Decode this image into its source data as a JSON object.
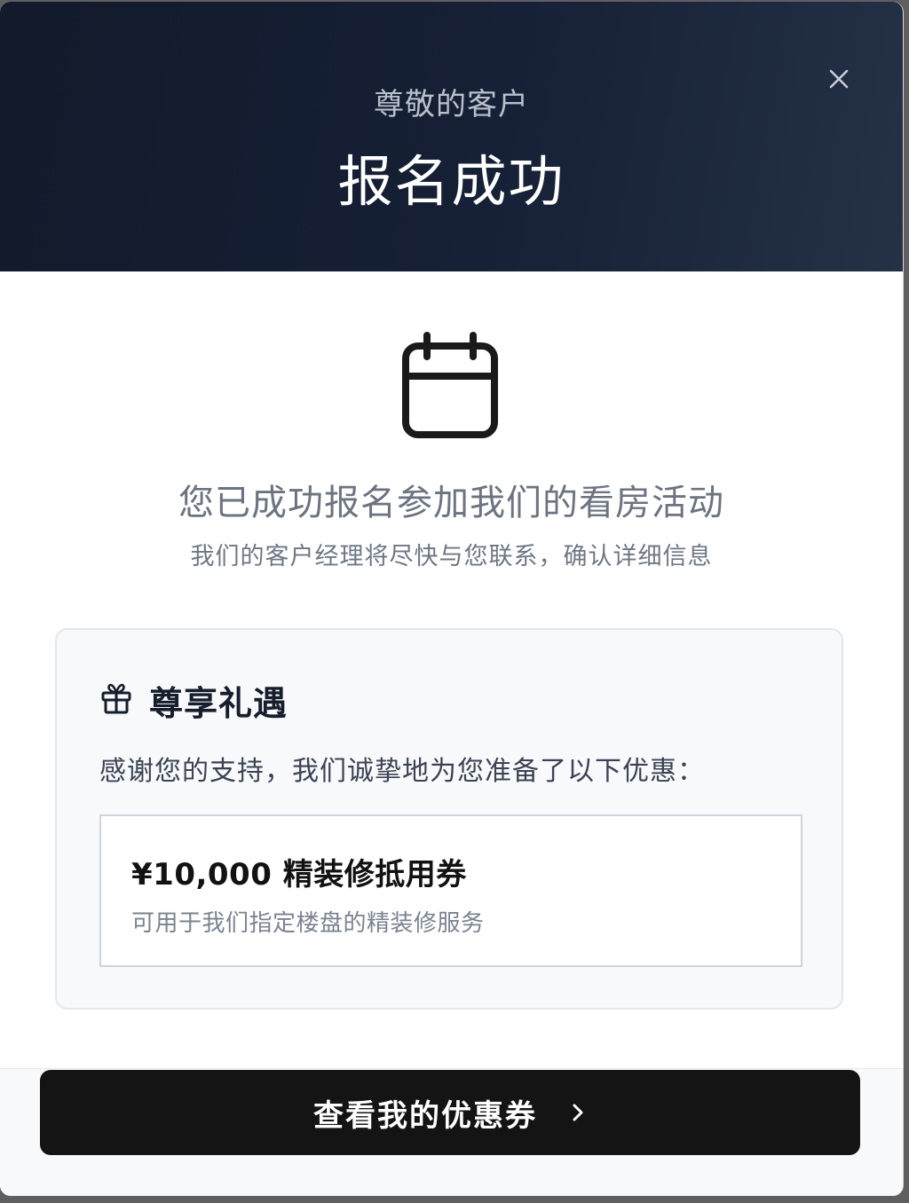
{
  "header": {
    "greeting": "尊敬的客户",
    "title": "报名成功",
    "close_icon": "close-icon"
  },
  "confirmation": {
    "icon": "calendar-icon",
    "message": "您已成功报名参加我们的看房活动",
    "sub_message": "我们的客户经理将尽快与您联系，确认详细信息"
  },
  "perks": {
    "icon": "gift-icon",
    "title": "尊享礼遇",
    "description": "感谢您的支持，我们诚挚地为您准备了以下优惠：",
    "voucher": {
      "title": "¥10,000 精装修抵用券",
      "description": "可用于我们指定楼盘的精装修服务"
    }
  },
  "cta": {
    "label": "查看我的优惠券",
    "icon": "chevron-right-icon"
  },
  "colors": {
    "header_bg": "#121a2b",
    "cta_bg": "#141414",
    "card_bg": "#f7f9fb"
  }
}
